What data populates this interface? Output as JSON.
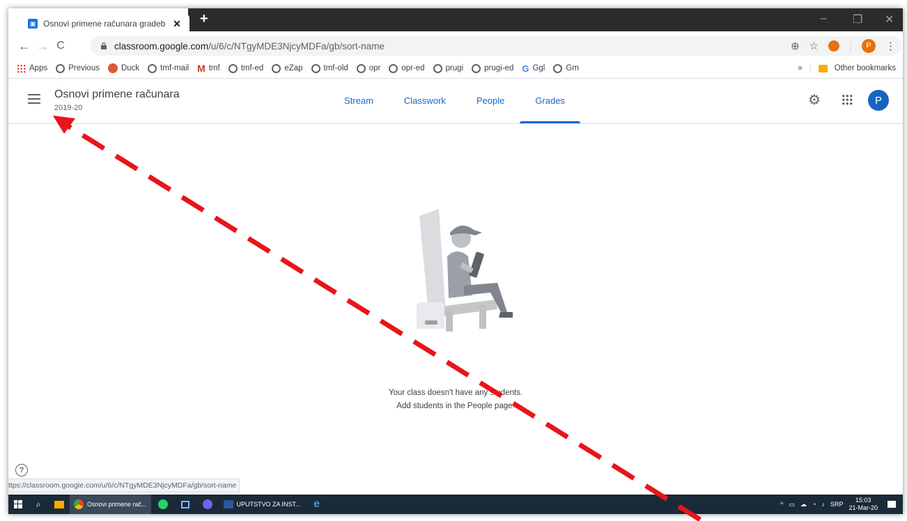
{
  "browser": {
    "tab_title": "Osnovi primene računara gradeb",
    "new_tab": "+",
    "url_host": "classroom.google.com",
    "url_path": "/u/6/c/NTgyMDE3NjcyMDFa/gb/sort-name",
    "profile_initial": "P",
    "window_controls": [
      "–",
      "❐",
      "✕"
    ]
  },
  "bookmarks": {
    "items": [
      {
        "label": "Apps",
        "icon": "apps-grid-icon"
      },
      {
        "label": "Previous",
        "icon": "globe-icon"
      },
      {
        "label": "Duck",
        "icon": "duckduckgo-icon"
      },
      {
        "label": "tmf-mail",
        "icon": "globe-icon"
      },
      {
        "label": "tmf",
        "icon": "gmail-icon"
      },
      {
        "label": "tmf-ed",
        "icon": "globe-icon"
      },
      {
        "label": "eZap",
        "icon": "globe-icon"
      },
      {
        "label": "tmf-old",
        "icon": "globe-icon"
      },
      {
        "label": "opr",
        "icon": "globe-icon"
      },
      {
        "label": "opr-ed",
        "icon": "globe-icon"
      },
      {
        "label": "prugi",
        "icon": "globe-icon"
      },
      {
        "label": "prugi-ed",
        "icon": "globe-icon"
      },
      {
        "label": "Ggl",
        "icon": "google-icon"
      },
      {
        "label": "Gm",
        "icon": "globe-icon"
      }
    ],
    "overflow": "»",
    "other": "Other bookmarks"
  },
  "classroom": {
    "class_name": "Osnovi primene računara",
    "class_section": "2019-20",
    "tabs": [
      "Stream",
      "Classwork",
      "People",
      "Grades"
    ],
    "active_tab": "Grades",
    "user_initial": "P",
    "accent": "#1967d2"
  },
  "empty_state": {
    "line1": "Your class doesn't have any students.",
    "line2": "Add students in the People page."
  },
  "status_url": "ttps://classroom.google.com/u/6/c/NTgyMDE3NjcyMDFa/gb/sort-name",
  "taskbar": {
    "chrome_label": "Osnovi primene rač...",
    "word_label": "UPUTSTVO ZA INST...",
    "lang": "SRP",
    "time": "15:03",
    "date": "21-Mar-20"
  },
  "annotation": {
    "color": "#e8151b"
  }
}
